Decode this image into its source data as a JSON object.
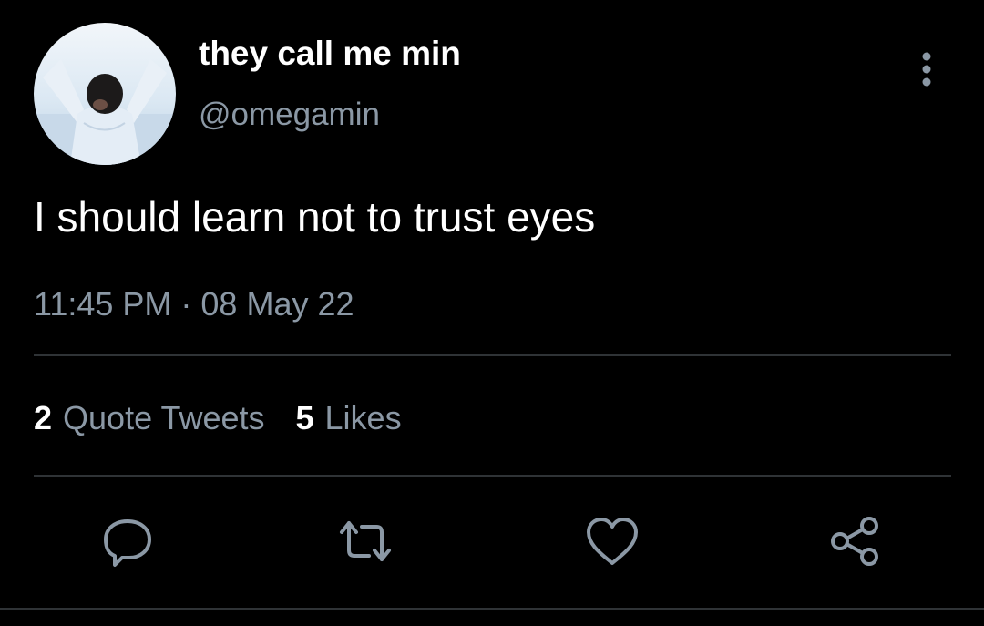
{
  "tweet": {
    "author": {
      "display_name": "they call me min",
      "handle": "@omegamin"
    },
    "text": "I should learn not to trust eyes",
    "timestamp": "11:45 PM · 08 May 22"
  },
  "stats": [
    {
      "count": "2",
      "label": "Quote Tweets"
    },
    {
      "count": "5",
      "label": "Likes"
    }
  ],
  "actions": [
    "reply-icon",
    "retweet-icon",
    "like-icon",
    "share-icon"
  ],
  "colors": {
    "background": "#000000",
    "primary_text": "#ffffff",
    "secondary_text": "#8b98a5",
    "divider": "#2f3336"
  }
}
